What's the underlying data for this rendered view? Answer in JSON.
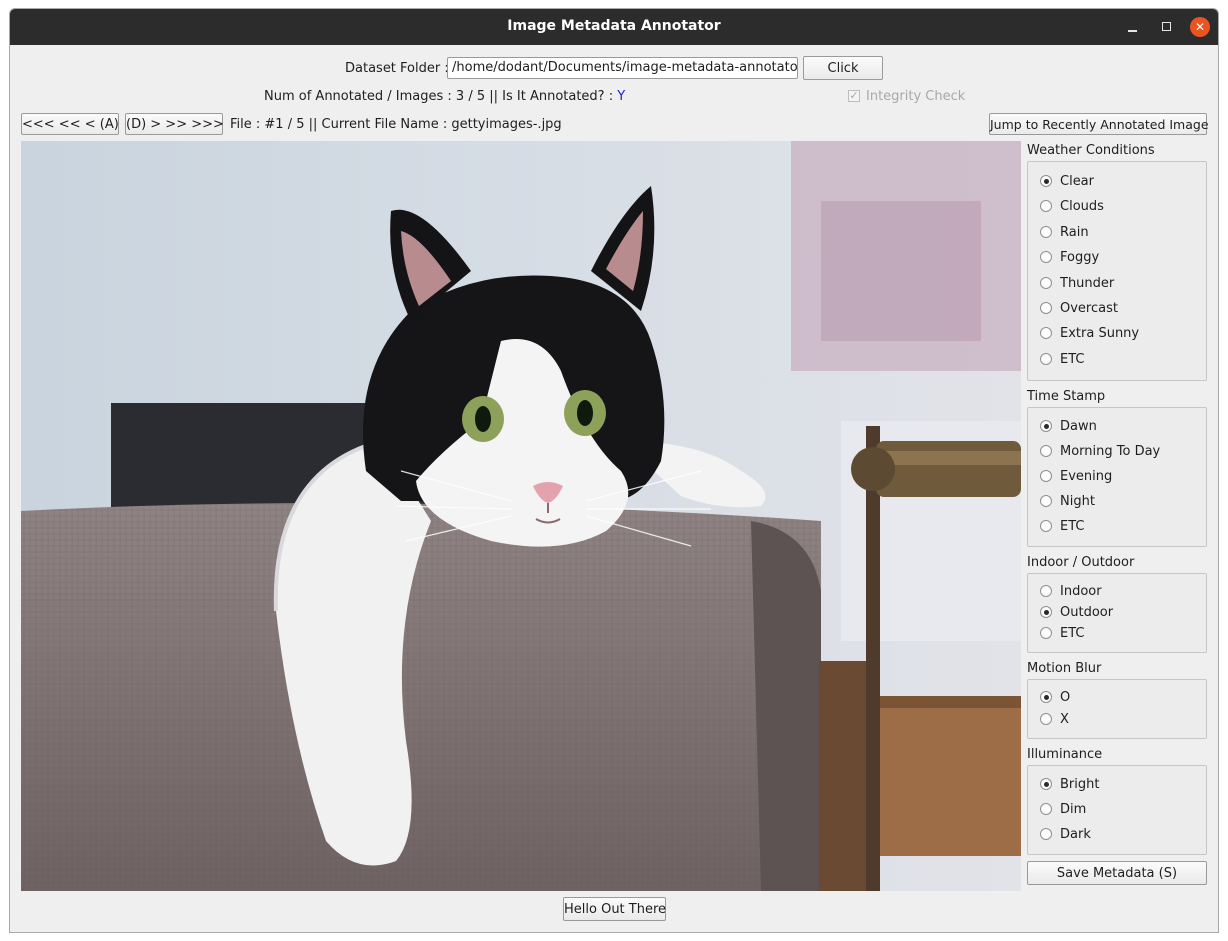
{
  "window": {
    "title": "Image Metadata Annotator",
    "close_glyph": "✕"
  },
  "folder": {
    "label": "Dataset Folder :",
    "value": "/home/dodant/Documents/image-metadata-annotator",
    "button": "Click"
  },
  "status": {
    "annotated_prefix": "Num of Annotated / Images : 3 / 5 || Is It Annotated? :",
    "annotated_flag": "Y",
    "integrity_label": "Integrity Check",
    "integrity_checked": true
  },
  "nav": {
    "prev": "<<< << < (A)",
    "next": "(D) > >> >>>",
    "file_info": "File : #1 / 5  ||  Current File Name : gettyimages-.jpg",
    "jump": "Jump to Recently Annotated Image"
  },
  "image": {
    "subject": "black-and-white cat on a sofa arm"
  },
  "groups": [
    {
      "title": "Weather Conditions",
      "options": [
        "Clear",
        "Clouds",
        "Rain",
        "Foggy",
        "Thunder",
        "Overcast",
        "Extra Sunny",
        "ETC"
      ],
      "selected": 0
    },
    {
      "title": "Time Stamp",
      "options": [
        "Dawn",
        "Morning To Day",
        "Evening",
        "Night",
        "ETC"
      ],
      "selected": 0
    },
    {
      "title": "Indoor / Outdoor",
      "options": [
        "Indoor",
        "Outdoor",
        "ETC"
      ],
      "selected": 1
    },
    {
      "title": "Motion Blur",
      "options": [
        "O",
        "X"
      ],
      "selected": 0
    },
    {
      "title": "Illuminance",
      "options": [
        "Bright",
        "Dim",
        "Dark"
      ],
      "selected": 0
    }
  ],
  "actions": {
    "save": "Save Metadata (S)",
    "hello": "Hello Out There"
  },
  "colors": {
    "annotated_flag": "#2121c8",
    "titlebar": "#2c2c2c",
    "close": "#e95420"
  }
}
